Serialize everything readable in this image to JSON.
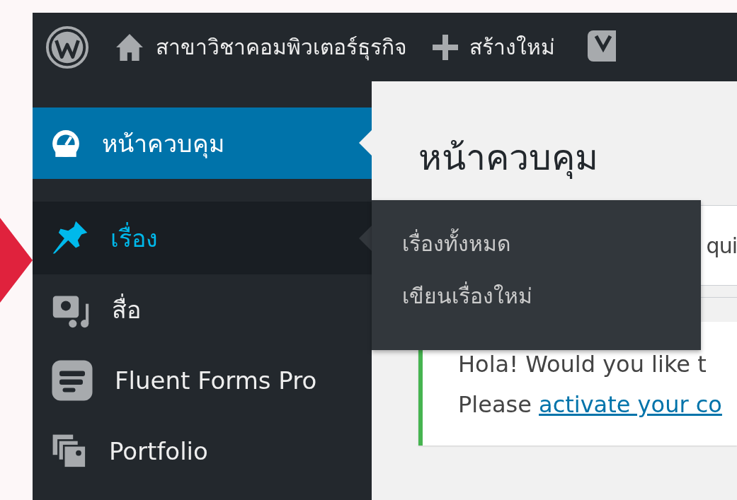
{
  "admin_bar": {
    "site_name": "สาขาวิชาคอมพิวเตอร์ธุรกิจ",
    "new_label": "สร้างใหม่"
  },
  "sidebar": {
    "items": [
      {
        "label": "หน้าควบคุม",
        "selected": true,
        "expanded": false
      },
      {
        "label": "เรื่อง",
        "selected": false,
        "expanded": true,
        "children": [
          {
            "label": "เรื่องทั้งหมด"
          },
          {
            "label": "เขียนเรื่องใหม่"
          }
        ]
      },
      {
        "label": "สื่อ",
        "selected": false,
        "expanded": false
      },
      {
        "label": "Fluent Forms Pro",
        "selected": false,
        "expanded": false
      },
      {
        "label": "Portfolio",
        "selected": false,
        "expanded": false
      }
    ]
  },
  "page": {
    "title": "หน้าควบคุม",
    "panel_text": "qui",
    "notice": {
      "line_1": "Hola! Would you like t",
      "line_2_prefix": "Please",
      "link": "activate your co"
    }
  }
}
